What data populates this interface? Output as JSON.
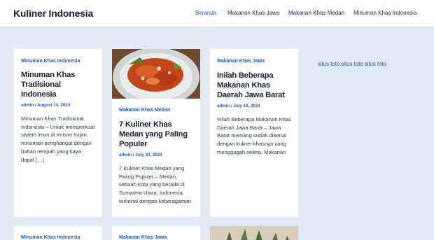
{
  "header": {
    "site_title": "Kuliner Indonesia",
    "nav": [
      {
        "label": "Beranda",
        "active": true
      },
      {
        "label": "Makanan Khas Jawa",
        "active": false
      },
      {
        "label": "Makanan Khas Medan",
        "active": false
      },
      {
        "label": "Minuman Khas Indonesia",
        "active": false
      }
    ]
  },
  "posts": [
    {
      "category": "Minuman Khas Indonesia",
      "title": "Minuman Khas Tradisional Indonesia",
      "author": "admin",
      "date": "August 14, 2024",
      "excerpt": "Minuman Khas Tradisional Indonesia – Untuk memperkuat sistem imun di musim hujan, minuman penghangat dengan bahan rempah yang kaya dapat […]"
    },
    {
      "category": "Makanan Khas Medan",
      "title": "7 Kuliner Khas Medan yang Paling Populer",
      "author": "admin",
      "date": "July 30, 2024",
      "excerpt": "7 Kuliner Khas Medan yang Paling Populer – Medan, sebuah kota yang berada di Sumatera Utara, Indonesia, terkenal dengan keberagaman"
    },
    {
      "category": "Makanan Khas Jawa",
      "title": "Inilah Beberapa Makanan Khas Daerah Jawa Barat",
      "author": "admin",
      "date": "July 10, 2024",
      "excerpt": "Inilah Beberapa Makanan Khas Daerah Jawa Barat – Jawa Barat memang sudah dikenal dengan kuliner khasnya yang menggugah selera. Makanan"
    }
  ],
  "second_row": [
    {
      "category": "Minuman Khas Indonesia"
    },
    {
      "category": "Makanan Khas Jawa"
    }
  ],
  "sidebar": {
    "text": "situs toto situs toto situs toto"
  },
  "colors": {
    "accent": "#1b59c2",
    "background": "#e3eaf3"
  }
}
